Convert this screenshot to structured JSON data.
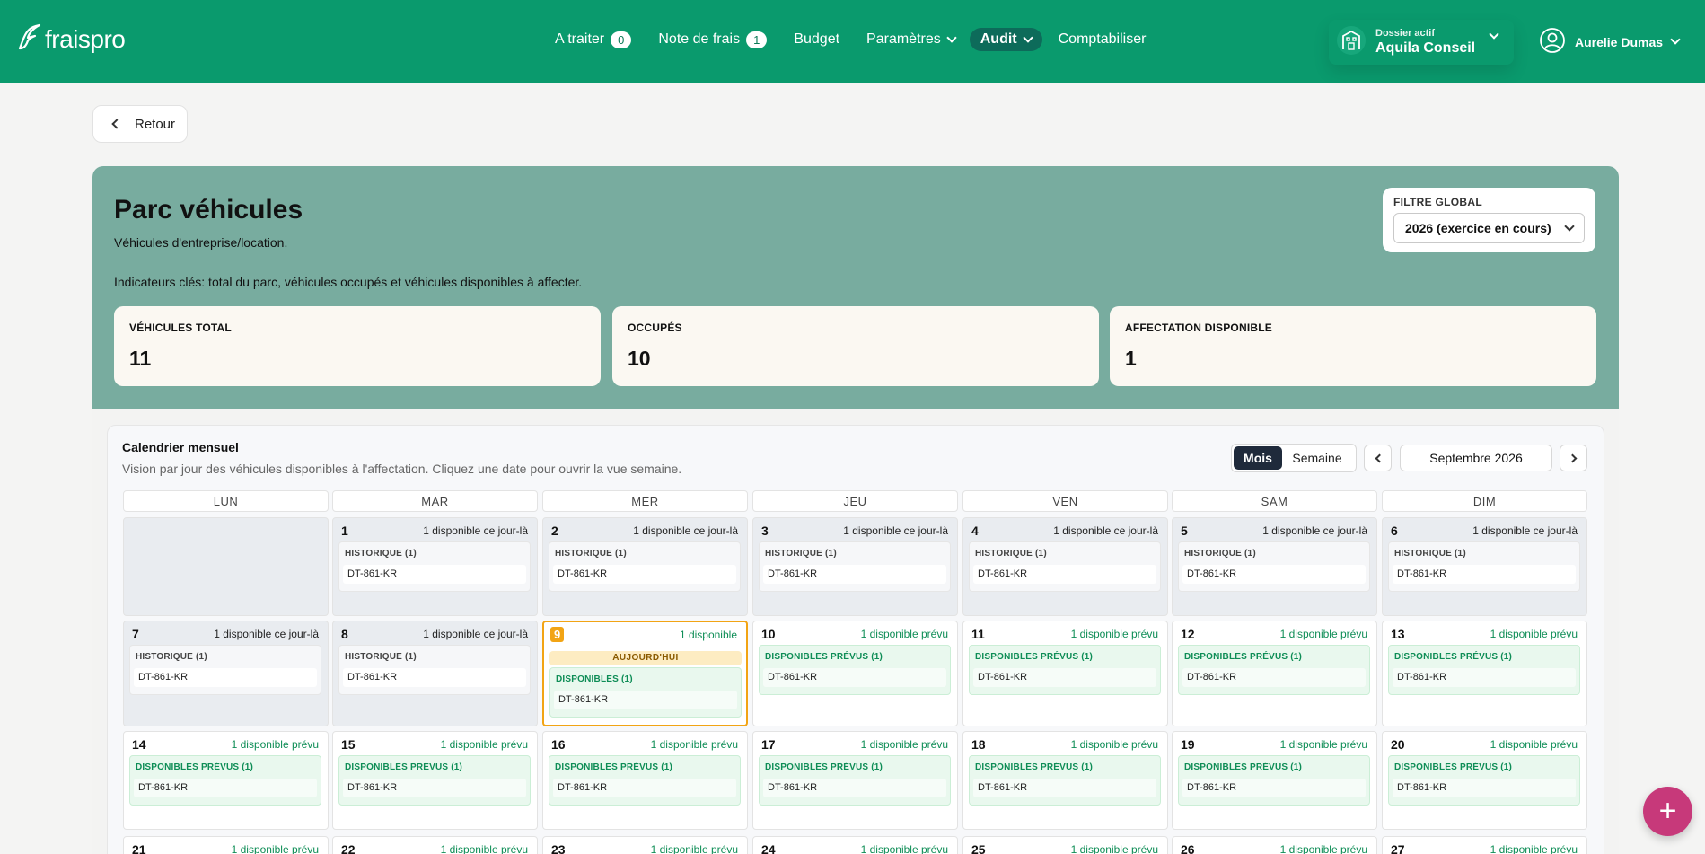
{
  "app": {
    "name": "fraispro"
  },
  "nav": {
    "a_traiter": {
      "label": "A traiter",
      "count": "0"
    },
    "note_de_frais": {
      "label": "Note de frais",
      "count": "1"
    },
    "budget": "Budget",
    "parametres": "Paramètres",
    "audit": "Audit",
    "comptabiliser": "Comptabiliser"
  },
  "dossier": {
    "small": "Dossier actif",
    "name": "Aquila Conseil"
  },
  "user": {
    "name": "Aurelie Dumas"
  },
  "back_label": "Retour",
  "hero": {
    "title": "Parc véhicules",
    "subtitle": "Véhicules d'entreprise/location.",
    "description": "Indicateurs clés: total du parc, véhicules occupés et véhicules disponibles à affecter.",
    "filter": {
      "label": "FILTRE GLOBAL",
      "value": "2026 (exercice en cours)"
    },
    "kpis": [
      {
        "label": "VÉHICULES TOTAL",
        "value": "11"
      },
      {
        "label": "OCCUPÉS",
        "value": "10"
      },
      {
        "label": "AFFECTATION DISPONIBLE",
        "value": "1"
      }
    ]
  },
  "calendar": {
    "title": "Calendrier mensuel",
    "subtitle": "Vision par jour des véhicules disponibles à l'affectation. Cliquez une date pour ouvrir la vue semaine.",
    "toggle": {
      "month": "Mois",
      "week": "Semaine"
    },
    "month_label": "Septembre 2026",
    "weekdays": [
      "LUN",
      "MAR",
      "MER",
      "JEU",
      "VEN",
      "SAM",
      "DIM"
    ],
    "today_label": "AUJOURD'HUI",
    "weeks": [
      [
        null,
        {
          "date": "1",
          "avail": "1 disponible ce jour-là",
          "kind": "past",
          "box_label": "HISTORIQUE (1)",
          "plate": "DT-861-KR"
        },
        {
          "date": "2",
          "avail": "1 disponible ce jour-là",
          "kind": "past",
          "box_label": "HISTORIQUE (1)",
          "plate": "DT-861-KR"
        },
        {
          "date": "3",
          "avail": "1 disponible ce jour-là",
          "kind": "past",
          "box_label": "HISTORIQUE (1)",
          "plate": "DT-861-KR"
        },
        {
          "date": "4",
          "avail": "1 disponible ce jour-là",
          "kind": "past",
          "box_label": "HISTORIQUE (1)",
          "plate": "DT-861-KR"
        },
        {
          "date": "5",
          "avail": "1 disponible ce jour-là",
          "kind": "past",
          "box_label": "HISTORIQUE (1)",
          "plate": "DT-861-KR"
        },
        {
          "date": "6",
          "avail": "1 disponible ce jour-là",
          "kind": "past",
          "box_label": "HISTORIQUE (1)",
          "plate": "DT-861-KR"
        }
      ],
      [
        {
          "date": "7",
          "avail": "1 disponible ce jour-là",
          "kind": "past",
          "box_label": "HISTORIQUE (1)",
          "plate": "DT-861-KR"
        },
        {
          "date": "8",
          "avail": "1 disponible ce jour-là",
          "kind": "past",
          "box_label": "HISTORIQUE (1)",
          "plate": "DT-861-KR"
        },
        {
          "date": "9",
          "avail": "1 disponible",
          "kind": "today",
          "box_label": "DISPONIBLES (1)",
          "plate": "DT-861-KR"
        },
        {
          "date": "10",
          "avail": "1 disponible prévu",
          "kind": "future",
          "box_label": "DISPONIBLES PRÉVUS (1)",
          "plate": "DT-861-KR"
        },
        {
          "date": "11",
          "avail": "1 disponible prévu",
          "kind": "future",
          "box_label": "DISPONIBLES PRÉVUS (1)",
          "plate": "DT-861-KR"
        },
        {
          "date": "12",
          "avail": "1 disponible prévu",
          "kind": "future",
          "box_label": "DISPONIBLES PRÉVUS (1)",
          "plate": "DT-861-KR"
        },
        {
          "date": "13",
          "avail": "1 disponible prévu",
          "kind": "future",
          "box_label": "DISPONIBLES PRÉVUS (1)",
          "plate": "DT-861-KR"
        }
      ],
      [
        {
          "date": "14",
          "avail": "1 disponible prévu",
          "kind": "future",
          "box_label": "DISPONIBLES PRÉVUS (1)",
          "plate": "DT-861-KR"
        },
        {
          "date": "15",
          "avail": "1 disponible prévu",
          "kind": "future",
          "box_label": "DISPONIBLES PRÉVUS (1)",
          "plate": "DT-861-KR"
        },
        {
          "date": "16",
          "avail": "1 disponible prévu",
          "kind": "future",
          "box_label": "DISPONIBLES PRÉVUS (1)",
          "plate": "DT-861-KR"
        },
        {
          "date": "17",
          "avail": "1 disponible prévu",
          "kind": "future",
          "box_label": "DISPONIBLES PRÉVUS (1)",
          "plate": "DT-861-KR"
        },
        {
          "date": "18",
          "avail": "1 disponible prévu",
          "kind": "future",
          "box_label": "DISPONIBLES PRÉVUS (1)",
          "plate": "DT-861-KR"
        },
        {
          "date": "19",
          "avail": "1 disponible prévu",
          "kind": "future",
          "box_label": "DISPONIBLES PRÉVUS (1)",
          "plate": "DT-861-KR"
        },
        {
          "date": "20",
          "avail": "1 disponible prévu",
          "kind": "future",
          "box_label": "DISPONIBLES PRÉVUS (1)",
          "plate": "DT-861-KR"
        }
      ],
      [
        {
          "date": "21",
          "avail": "1 disponible prévu",
          "kind": "future"
        },
        {
          "date": "22",
          "avail": "1 disponible prévu",
          "kind": "future"
        },
        {
          "date": "23",
          "avail": "1 disponible prévu",
          "kind": "future"
        },
        {
          "date": "24",
          "avail": "1 disponible prévu",
          "kind": "future"
        },
        {
          "date": "25",
          "avail": "1 disponible prévu",
          "kind": "future"
        },
        {
          "date": "26",
          "avail": "1 disponible prévu",
          "kind": "future"
        },
        {
          "date": "27",
          "avail": "1 disponible prévu",
          "kind": "future"
        }
      ]
    ]
  },
  "fab": {
    "icon": "plus-icon",
    "glyph": "+"
  },
  "colors": {
    "brand": "#0a9a6d",
    "hero": "#78ac9f",
    "today": "#f2a414",
    "fab": "#c7397a"
  }
}
